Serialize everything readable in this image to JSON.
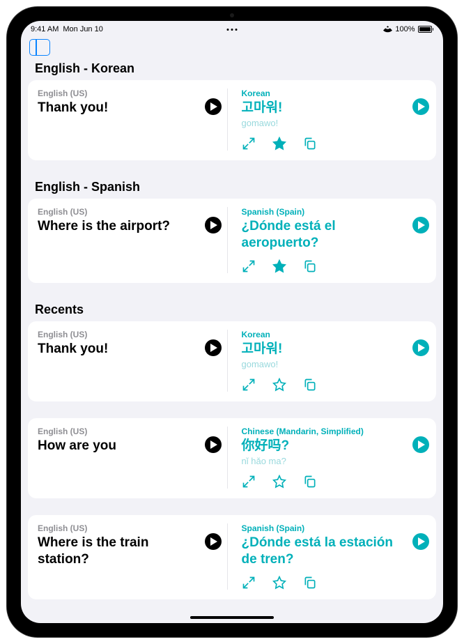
{
  "status": {
    "time": "9:41 AM",
    "date": "Mon Jun 10",
    "battery_pct": "100%"
  },
  "sections": [
    {
      "header": "English - Korean",
      "items": [
        {
          "src_lang": "English (US)",
          "src_text": "Thank you!",
          "tgt_lang": "Korean",
          "tgt_text": "고마워!",
          "romanization": "gomawo!",
          "favorited": true
        }
      ]
    },
    {
      "header": "English - Spanish",
      "items": [
        {
          "src_lang": "English (US)",
          "src_text": "Where is the airport?",
          "tgt_lang": "Spanish (Spain)",
          "tgt_text": "¿Dónde está el aeropuerto?",
          "romanization": "",
          "favorited": true
        }
      ]
    },
    {
      "header": "Recents",
      "items": [
        {
          "src_lang": "English (US)",
          "src_text": "Thank you!",
          "tgt_lang": "Korean",
          "tgt_text": "고마워!",
          "romanization": "gomawo!",
          "favorited": false
        },
        {
          "src_lang": "English (US)",
          "src_text": "How are you",
          "tgt_lang": "Chinese (Mandarin, Simplified)",
          "tgt_text": "你好吗?",
          "romanization": "nǐ hǎo ma?",
          "favorited": false
        },
        {
          "src_lang": "English (US)",
          "src_text": "Where is the train station?",
          "tgt_lang": "Spanish (Spain)",
          "tgt_text": "¿Dónde está la estación de tren?",
          "romanization": "",
          "favorited": false
        }
      ]
    }
  ]
}
